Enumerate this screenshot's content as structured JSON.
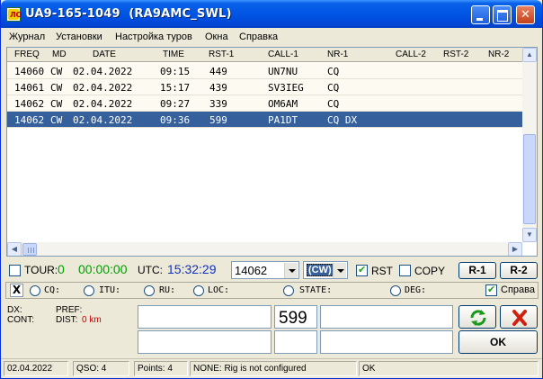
{
  "window": {
    "title": "UA9-165-1049  (RA9AMC_SWL)",
    "icon": "app-logo-icon",
    "icon_text": "ЛΟ"
  },
  "menu": [
    "Журнал",
    "Установки",
    "Настройка туров",
    "Окна",
    "Справка"
  ],
  "log": {
    "columns": [
      "FREQ",
      "MD",
      "DATE",
      "TIME",
      "RST-1",
      "CALL-1",
      "NR-1",
      "CALL-2",
      "RST-2",
      "NR-2"
    ],
    "rows": [
      {
        "freq": "14060",
        "md": "CW",
        "date": "02.04.2022",
        "time": "09:15",
        "rst1": "449",
        "call1": "UN7NU",
        "nr1": "CQ",
        "selected": false
      },
      {
        "freq": "14061",
        "md": "CW",
        "date": "02.04.2022",
        "time": "15:17",
        "rst1": "439",
        "call1": "SV3IEG",
        "nr1": "CQ",
        "selected": false
      },
      {
        "freq": "14062",
        "md": "CW",
        "date": "02.04.2022",
        "time": "09:27",
        "rst1": "339",
        "call1": "OM6AM",
        "nr1": "CQ",
        "selected": false
      },
      {
        "freq": "14062",
        "md": "CW",
        "date": "02.04.2022",
        "time": "09:36",
        "rst1": "599",
        "call1": "PA1DT",
        "nr1": "CQ DX",
        "selected": true
      }
    ]
  },
  "controls": {
    "tour_label": "TOUR:",
    "tour_checked": false,
    "tour_count": "0",
    "timer": "00:00:00",
    "utc_label": "UTC:",
    "utc_time": "15:32:29",
    "freq_value": "14062",
    "mode_value": "(CW)",
    "rst_label": "RST",
    "rst_checked": true,
    "copy_label": "COPY",
    "copy_checked": false,
    "r1_label": "R-1",
    "r2_label": "R-2"
  },
  "search": {
    "close_label": "X",
    "options": [
      "CQ:",
      "ITU:",
      "RU:",
      "LOC:",
      "STATE:",
      "DEG:"
    ],
    "help_label": "Справа",
    "help_checked": true
  },
  "info": {
    "dx_label": "DX:",
    "cont_label": "CONT:",
    "pref_label": "PREF:",
    "dist_label": "DIST:",
    "dist_value": "0 km",
    "rst_value": "599",
    "refresh_icon": "refresh-icon",
    "delete_icon": "delete-icon",
    "ok_label": "OK"
  },
  "status": {
    "date": "02.04.2022",
    "qso": "QSO: 4",
    "points": "Points: 4",
    "rig": "NONE: Rig is not configured",
    "state": "OK"
  },
  "colors": {
    "title_bar": "#0055e5",
    "selected_row": "#35609b",
    "timer_green": "#00a000",
    "utc_blue": "#1030c0",
    "dist_red": "#cc0000"
  }
}
